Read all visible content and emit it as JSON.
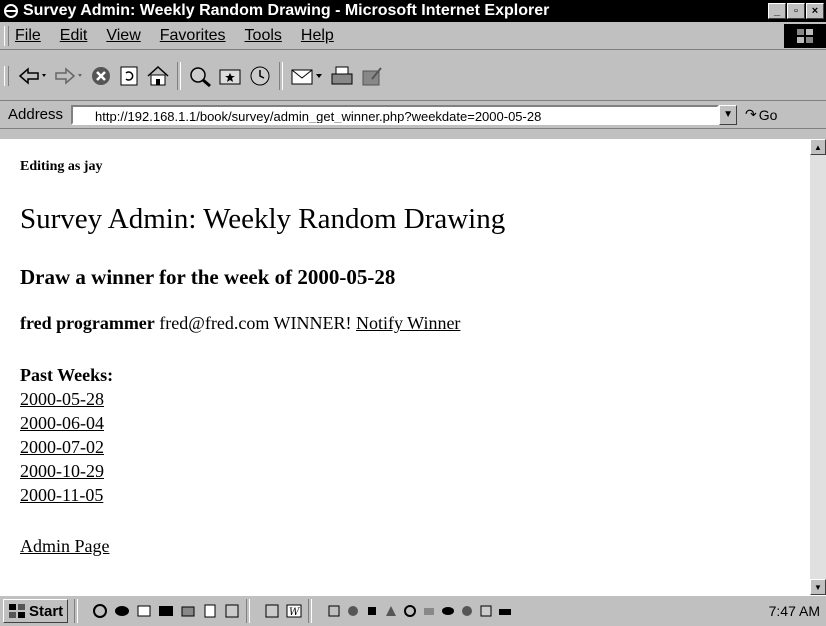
{
  "window": {
    "title": "Survey Admin: Weekly Random Drawing - Microsoft Internet Explorer",
    "buttons": {
      "minimize": "_",
      "maximize": "▫",
      "close": "×"
    }
  },
  "menu": [
    {
      "label": "File"
    },
    {
      "label": "Edit"
    },
    {
      "label": "View"
    },
    {
      "label": "Favorites"
    },
    {
      "label": "Tools"
    },
    {
      "label": "Help"
    }
  ],
  "toolbar": {
    "icons": [
      "back-icon",
      "forward-icon",
      "stop-icon",
      "refresh-icon",
      "home-icon",
      "search-icon",
      "favorites-icon",
      "history-icon",
      "mail-icon",
      "print-icon",
      "edit-icon"
    ]
  },
  "address": {
    "label": "Address",
    "url": "http://192.168.1.1/book/survey/admin_get_winner.php?weekdate=2000-05-28",
    "go_label": "Go"
  },
  "page": {
    "editing": "Editing as jay",
    "heading": "Survey Admin: Weekly Random Drawing",
    "subheading": "Draw a winner for the week of 2000-05-28",
    "winner_name": "fred programmer",
    "winner_email": "fred@fred.com",
    "winner_status": "WINNER!",
    "notify_link": "Notify Winner",
    "past_label": "Past Weeks:",
    "past_weeks": [
      "2000-05-28",
      "2000-06-04",
      "2000-07-02",
      "2000-10-29",
      "2000-11-05"
    ],
    "admin_link": "Admin Page"
  },
  "taskbar": {
    "start_label": "Start",
    "clock": "7:47 AM"
  }
}
